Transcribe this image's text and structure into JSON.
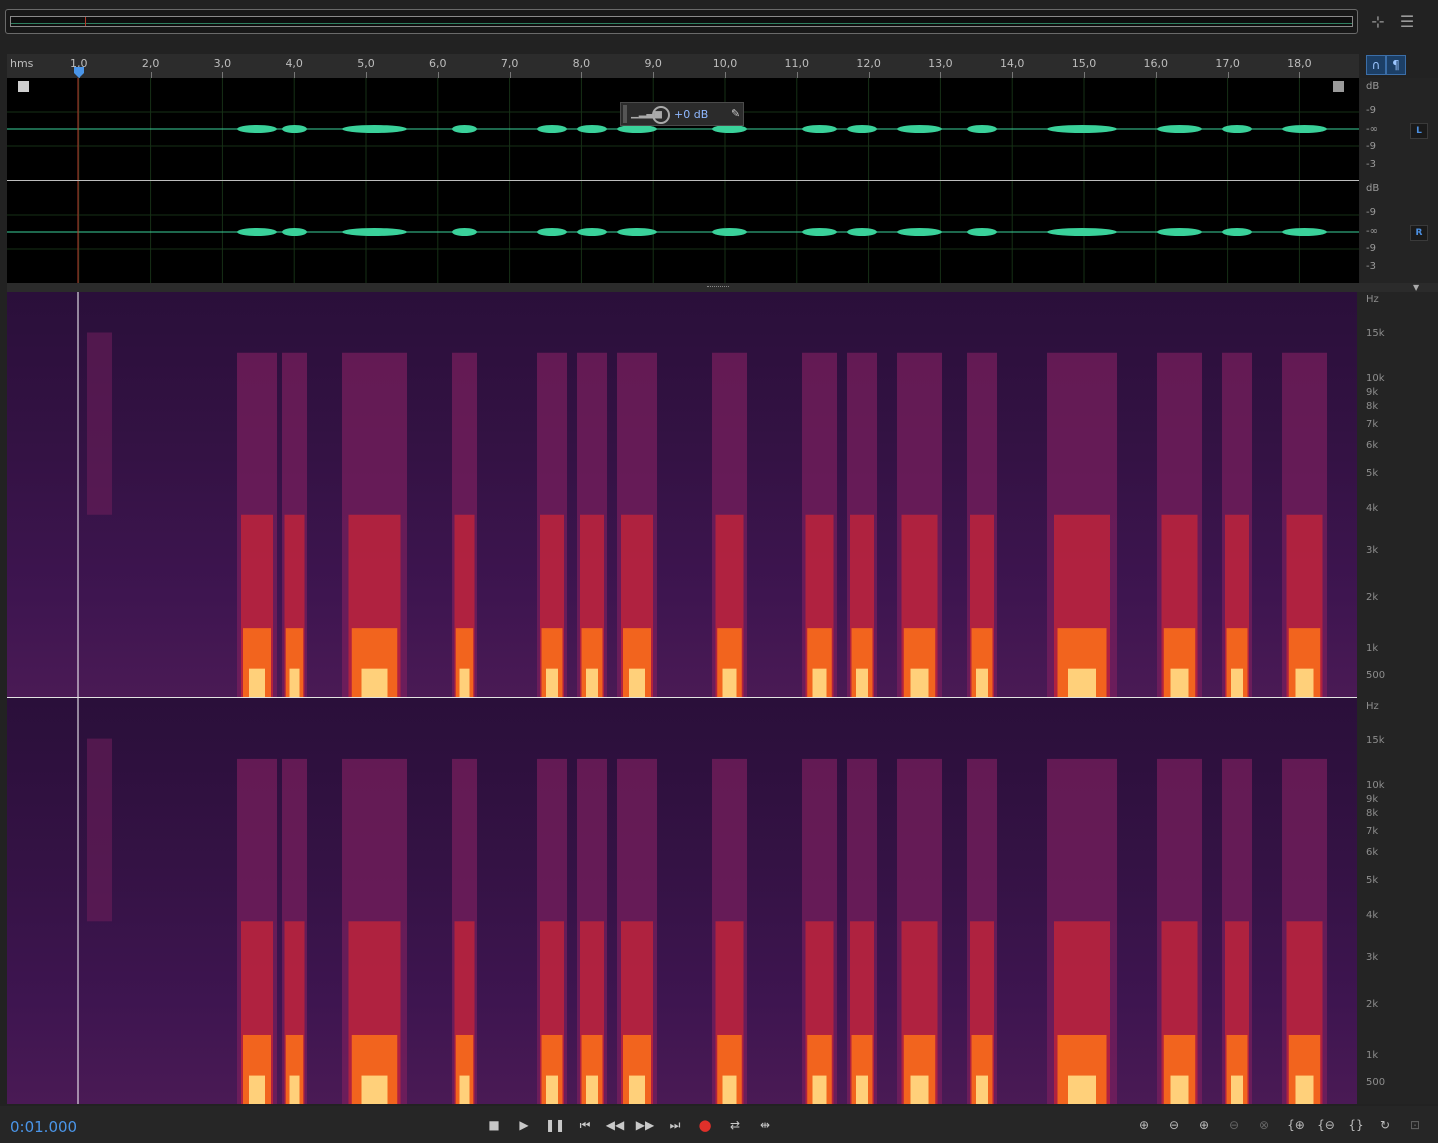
{
  "timecode": "0:01.000",
  "ruler": {
    "unit_label": "hms",
    "ticks": [
      "1,0",
      "2,0",
      "3,0",
      "4,0",
      "5,0",
      "6,0",
      "7,0",
      "8,0",
      "9,0",
      "10,0",
      "11,0",
      "12,0",
      "13,0",
      "14,0",
      "15,0",
      "16,0",
      "17,0",
      "18,0"
    ]
  },
  "hud": {
    "gain_label": "+0 dB"
  },
  "waveform": {
    "channels": [
      {
        "label": "L",
        "db_unit": "dB",
        "db_labels": [
          "-9",
          "-∞",
          "-9",
          "-3"
        ]
      },
      {
        "label": "R",
        "db_unit": "dB",
        "db_labels": [
          "-9",
          "-∞",
          "-9",
          "-3"
        ]
      }
    ]
  },
  "spectrogram": {
    "hz_unit": "Hz",
    "hz_labels": [
      "15k",
      "10k",
      "9k",
      "8k",
      "7k",
      "6k",
      "5k",
      "4k",
      "3k",
      "2k",
      "1k",
      "500"
    ]
  },
  "transport": [
    "stop-icon",
    "play-icon",
    "pause-icon",
    "go-to-start-icon",
    "rewind-icon",
    "fast-forward-icon",
    "go-to-end-icon",
    "record-icon",
    "loop-icon",
    "skip-selection-icon"
  ],
  "zoom_tools": [
    "zoom-in-amplitude-icon",
    "zoom-out-amplitude-icon",
    "zoom-in-time-icon",
    "zoom-out-time-icon",
    "zoom-full-icon",
    "zoom-in-selection-icon",
    "zoom-out-selection-icon",
    "zoom-selection-icon",
    "zoom-reset-icon",
    "zoom-fit-icon"
  ],
  "colors": {
    "accent": "#4a95e8",
    "waveform": "#3ad19a",
    "playhead": "#b53a2a",
    "record": "#e0302a"
  }
}
